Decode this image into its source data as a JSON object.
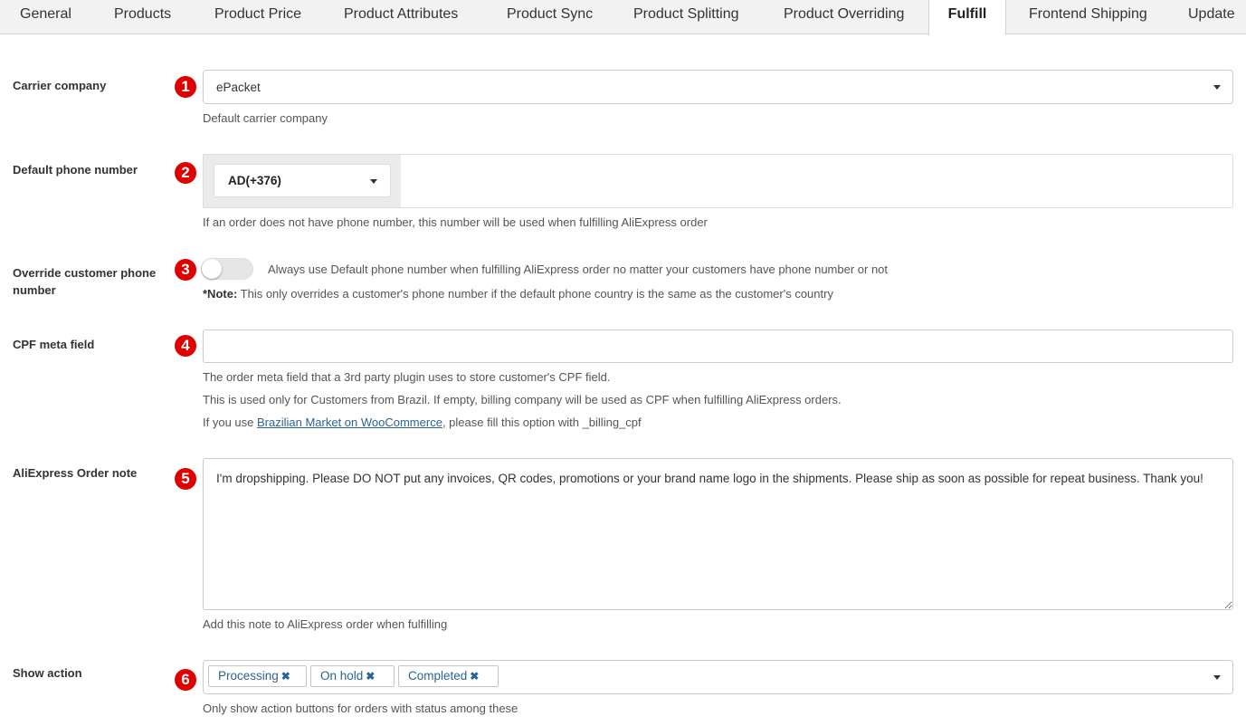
{
  "tabs": [
    {
      "label": "General"
    },
    {
      "label": "Products"
    },
    {
      "label": "Product Price"
    },
    {
      "label": "Product Attributes"
    },
    {
      "label": "Product Sync"
    },
    {
      "label": "Product Splitting"
    },
    {
      "label": "Product Overriding"
    },
    {
      "label": "Fulfill",
      "active": true
    },
    {
      "label": "Frontend Shipping"
    },
    {
      "label": "Update"
    }
  ],
  "markers": [
    "1",
    "2",
    "3",
    "4",
    "5",
    "6"
  ],
  "carrier": {
    "label": "Carrier company",
    "value": "ePacket",
    "help": "Default carrier company"
  },
  "phone": {
    "label": "Default phone number",
    "country_code": "AD(+376)",
    "value": "",
    "help": "If an order does not have phone number, this number will be used when fulfilling AliExpress order"
  },
  "override": {
    "label": "Override customer phone number",
    "enabled": false,
    "description": "Always use Default phone number when fulfilling AliExpress order no matter your customers have phone number or not",
    "note_bold": "*Note:",
    "note_text": " This only overrides a customer's phone number if the default phone country is the same as the customer's country"
  },
  "cpf": {
    "label": "CPF meta field",
    "value": "",
    "help1": "The order meta field that a 3rd party plugin uses to store customer's CPF field.",
    "help2": "This is used only for Customers from Brazil. If empty, billing company will be used as CPF when fulfilling AliExpress orders.",
    "help3_prefix": "If you use ",
    "help3_link": "Brazilian Market on WooCommerce",
    "help3_suffix": ", please fill this option with _billing_cpf"
  },
  "order_note": {
    "label": "AliExpress Order note",
    "value": "I'm dropshipping. Please DO NOT put any invoices, QR codes, promotions or your brand name logo in the shipments. Please ship as soon as possible for repeat business. Thank you!",
    "help": "Add this note to AliExpress order when fulfilling"
  },
  "show_action": {
    "label": "Show action",
    "chips": [
      "Processing",
      "On hold",
      "Completed"
    ],
    "remove_glyph": "✖",
    "help": "Only show action buttons for orders with status among these"
  },
  "colors": {
    "marker": "#e00000",
    "link": "#2a6496",
    "tab_bar": "#f2f2f2"
  }
}
